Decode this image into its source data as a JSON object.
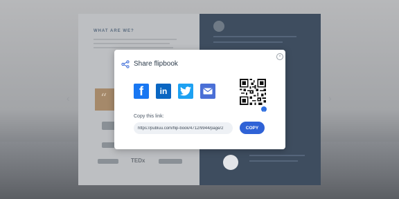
{
  "background": {
    "left_page_title": "WHAT ARE WE?",
    "tedx_label": "TEDx"
  },
  "modal": {
    "title": "Share flipbook",
    "close_glyph": "×",
    "social": [
      {
        "name": "facebook",
        "glyph": "f"
      },
      {
        "name": "linkedin",
        "glyph": "in"
      },
      {
        "name": "twitter",
        "glyph": ""
      },
      {
        "name": "email",
        "glyph": ""
      }
    ],
    "copy_label": "Copy this link:",
    "link_value": "https://publuu.com/flip-book/4712/9944/page/2",
    "copy_button": "COPY"
  },
  "colors": {
    "facebook": "#1877f2",
    "linkedin": "#0a66c2",
    "twitter": "#1da1f2",
    "email": "#4a6fd6",
    "copy_button": "#2f62d6"
  }
}
